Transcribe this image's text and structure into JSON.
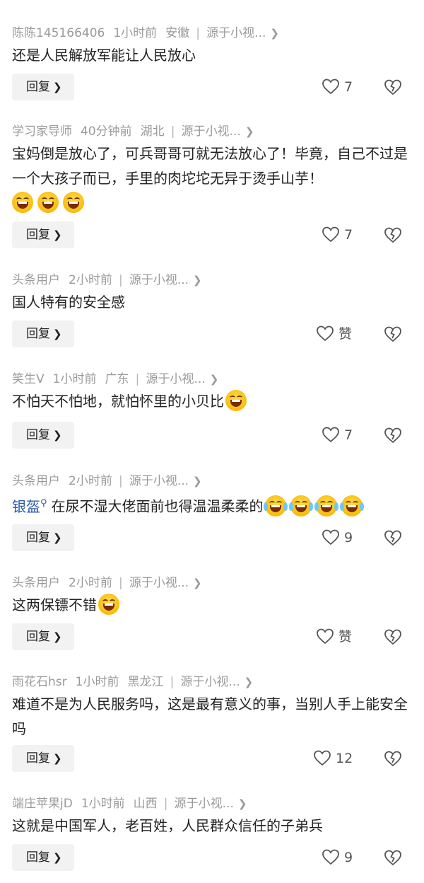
{
  "comments": [
    {
      "author": "陈陈145166406",
      "time": "1小时前",
      "location": "安徽",
      "source": "源于小视...",
      "text": "还是人民解放军能让人民放心",
      "reply_label": "回复",
      "likes": "7"
    },
    {
      "author": "学习家导师",
      "time": "40分钟前",
      "location": "湖北",
      "source": "源于小视...",
      "text": "宝妈倒是放心了，可兵哥哥可就无法放心了！毕竟，自己不过是一个大孩子而已，手里的肉坨坨无异于烫手山芋！",
      "reply_label": "回复",
      "likes": "7"
    },
    {
      "author": "头条用户",
      "time": "2小时前",
      "location": "",
      "source": "源于小视...",
      "text": "国人特有的安全感",
      "reply_label": "回复",
      "likes": "赞"
    },
    {
      "author": "笑生V",
      "time": "1小时前",
      "location": "广东",
      "source": "源于小视...",
      "text": "不怕天不怕地，就怕怀里的小贝比",
      "reply_label": "回复",
      "likes": "7"
    },
    {
      "author": "头条用户",
      "time": "2小时前",
      "location": "",
      "source": "源于小视...",
      "mention": "银盔",
      "text": "在尿不湿大佬面前也得温温柔柔的",
      "reply_label": "回复",
      "likes": "9"
    },
    {
      "author": "头条用户",
      "time": "2小时前",
      "location": "",
      "source": "源于小视...",
      "text": "这两保镖不错",
      "reply_label": "回复",
      "likes": "赞"
    },
    {
      "author": "雨花石hsr",
      "time": "1小时前",
      "location": "黑龙江",
      "source": "源于小视...",
      "text": "难道不是为人民服务吗，这是最有意义的事，当别人手上能安全吗",
      "reply_label": "回复",
      "likes": "12"
    },
    {
      "author": "端庄苹果jD",
      "time": "1小时前",
      "location": "山西",
      "source": "源于小视...",
      "text": "这就是中国军人，老百姓，人民群众信任的子弟兵",
      "reply_label": "回复",
      "likes": "9"
    }
  ],
  "icons": {
    "like": "heart-outline-icon",
    "dislike": "broken-heart-icon",
    "chevron": "chevron-right-icon",
    "emoji_grin": "grinning-emoji",
    "emoji_cry": "tears-of-joy-emoji"
  }
}
